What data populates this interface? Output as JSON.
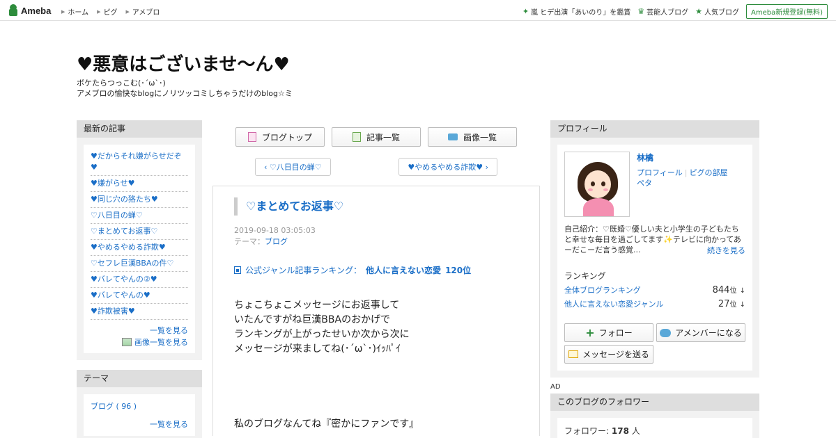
{
  "topbar": {
    "logo_text": "Ameba",
    "nav": [
      "ホーム",
      "ピグ",
      "アメブロ"
    ],
    "right_items": [
      {
        "label": "嵐 ヒデ出演「あいのり」を鑑賞",
        "icon": "sparkle-icon"
      },
      {
        "label": "芸能人ブログ",
        "icon": "crown-icon"
      },
      {
        "label": "人気ブログ",
        "icon": "star-icon"
      }
    ],
    "register_label": "Ameba新規登録(無料)"
  },
  "blog": {
    "title": "♥悪意はございませ～ん♥",
    "desc_line1": "ボケたらつっこむ(･´ω`･)",
    "desc_line2": "アメブロの愉快なblogにノリツッコミしちゃうだけのblog☆ミ"
  },
  "left": {
    "recent_head": "最新の記事",
    "recent_items": [
      "♥だからそれ嫌がらせだぞ♥",
      "♥嫌がらせ♥",
      "♥同じ穴の狢たち♥",
      "♡八日目の蝉♡",
      "♡まとめてお返事♡",
      "♥やめるやめる詐欺♥",
      "♡セフレ巨漢BBAの件♡",
      "♥バレてやんの②♥",
      "♥バレてやんの♥",
      "♥詐欺被害♥"
    ],
    "list_more": "一覧を見る",
    "image_more": "画像一覧を見る",
    "theme_head": "テーマ",
    "theme_item": "ブログ ( 96 )",
    "theme_more": "一覧を見る"
  },
  "center": {
    "tabs": [
      "ブログトップ",
      "記事一覧",
      "画像一覧"
    ],
    "prev": "♡八日目の蝉♡",
    "next": "♥やめるやめる詐欺♥",
    "article": {
      "title": "♡まとめてお返事♡",
      "date": "2019-09-18 03:05:03",
      "theme_label": "テーマ：",
      "theme_link": "ブログ",
      "ranking_label": "公式ジャンル記事ランキング：",
      "ranking_genre": "他人に言えない恋愛",
      "ranking_pos": "120位",
      "body": [
        "ちょこちょこメッセージにお返事して",
        "いたんですがね巨漢BBAのおかげで",
        "ランキングが上がったせいか次から次に",
        "メッセージが来ましてね(･´ω`･)ｲｯﾊﾟｲ"
      ],
      "body2": "私のブログなんてね『密かにファンです』"
    }
  },
  "right": {
    "profile_head": "プロフィール",
    "name": "林檎",
    "link_profile": "プロフィール",
    "link_pig": "ピグの部屋",
    "link_peta": "ペタ",
    "intro": "自己紹介：♡既婚♡優しい夫と小学生の子どもたちと幸せな毎日を過ごしてます✨テレビに向かってあーだこーだ言う感覚...",
    "more": "続きを見る",
    "ranking_head": "ランキング",
    "rank_all_label": "全体ブログランキング",
    "rank_all_val": "844",
    "rank_genre_label": "他人に言えない恋愛ジャンル",
    "rank_genre_val": "27",
    "rank_unit": "位",
    "rank_arrow": "↓",
    "follow_btn": "フォロー",
    "amember_btn": "アメンバーになる",
    "message_btn": "メッセージを送る",
    "ad": "AD",
    "followers_head": "このブログのフォロワー",
    "followers_label": "フォロワー:",
    "followers_count": "178",
    "followers_unit": "人"
  },
  "colors": {
    "link": "#1a6ec7",
    "brand_green": "#2d8c3c",
    "side_bg": "#f2f2f2"
  }
}
